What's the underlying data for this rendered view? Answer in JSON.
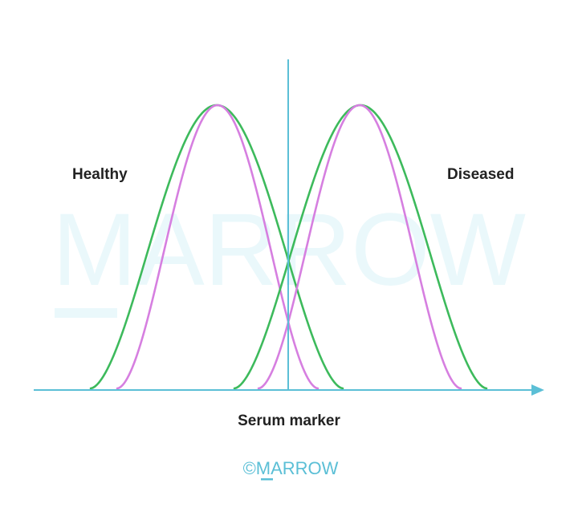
{
  "labels": {
    "left_population": "Healthy",
    "right_population": "Diseased",
    "x_axis": "Serum marker"
  },
  "watermark": {
    "text": "MARROW",
    "color": "#eaf8fb"
  },
  "brand": {
    "copyright_symbol": "©",
    "name": "MARROW",
    "color": "#5bbfd6"
  },
  "colors": {
    "axis": "#5bbfd6",
    "cutoff_line": "#5bbfd6",
    "green_curve": "#3dba5c",
    "pink_curve": "#d67fe0"
  },
  "curves": [
    {
      "population": "Healthy",
      "color": "green"
    },
    {
      "population": "Healthy",
      "color": "pink"
    },
    {
      "population": "Diseased",
      "color": "green"
    },
    {
      "population": "Diseased",
      "color": "pink"
    }
  ]
}
